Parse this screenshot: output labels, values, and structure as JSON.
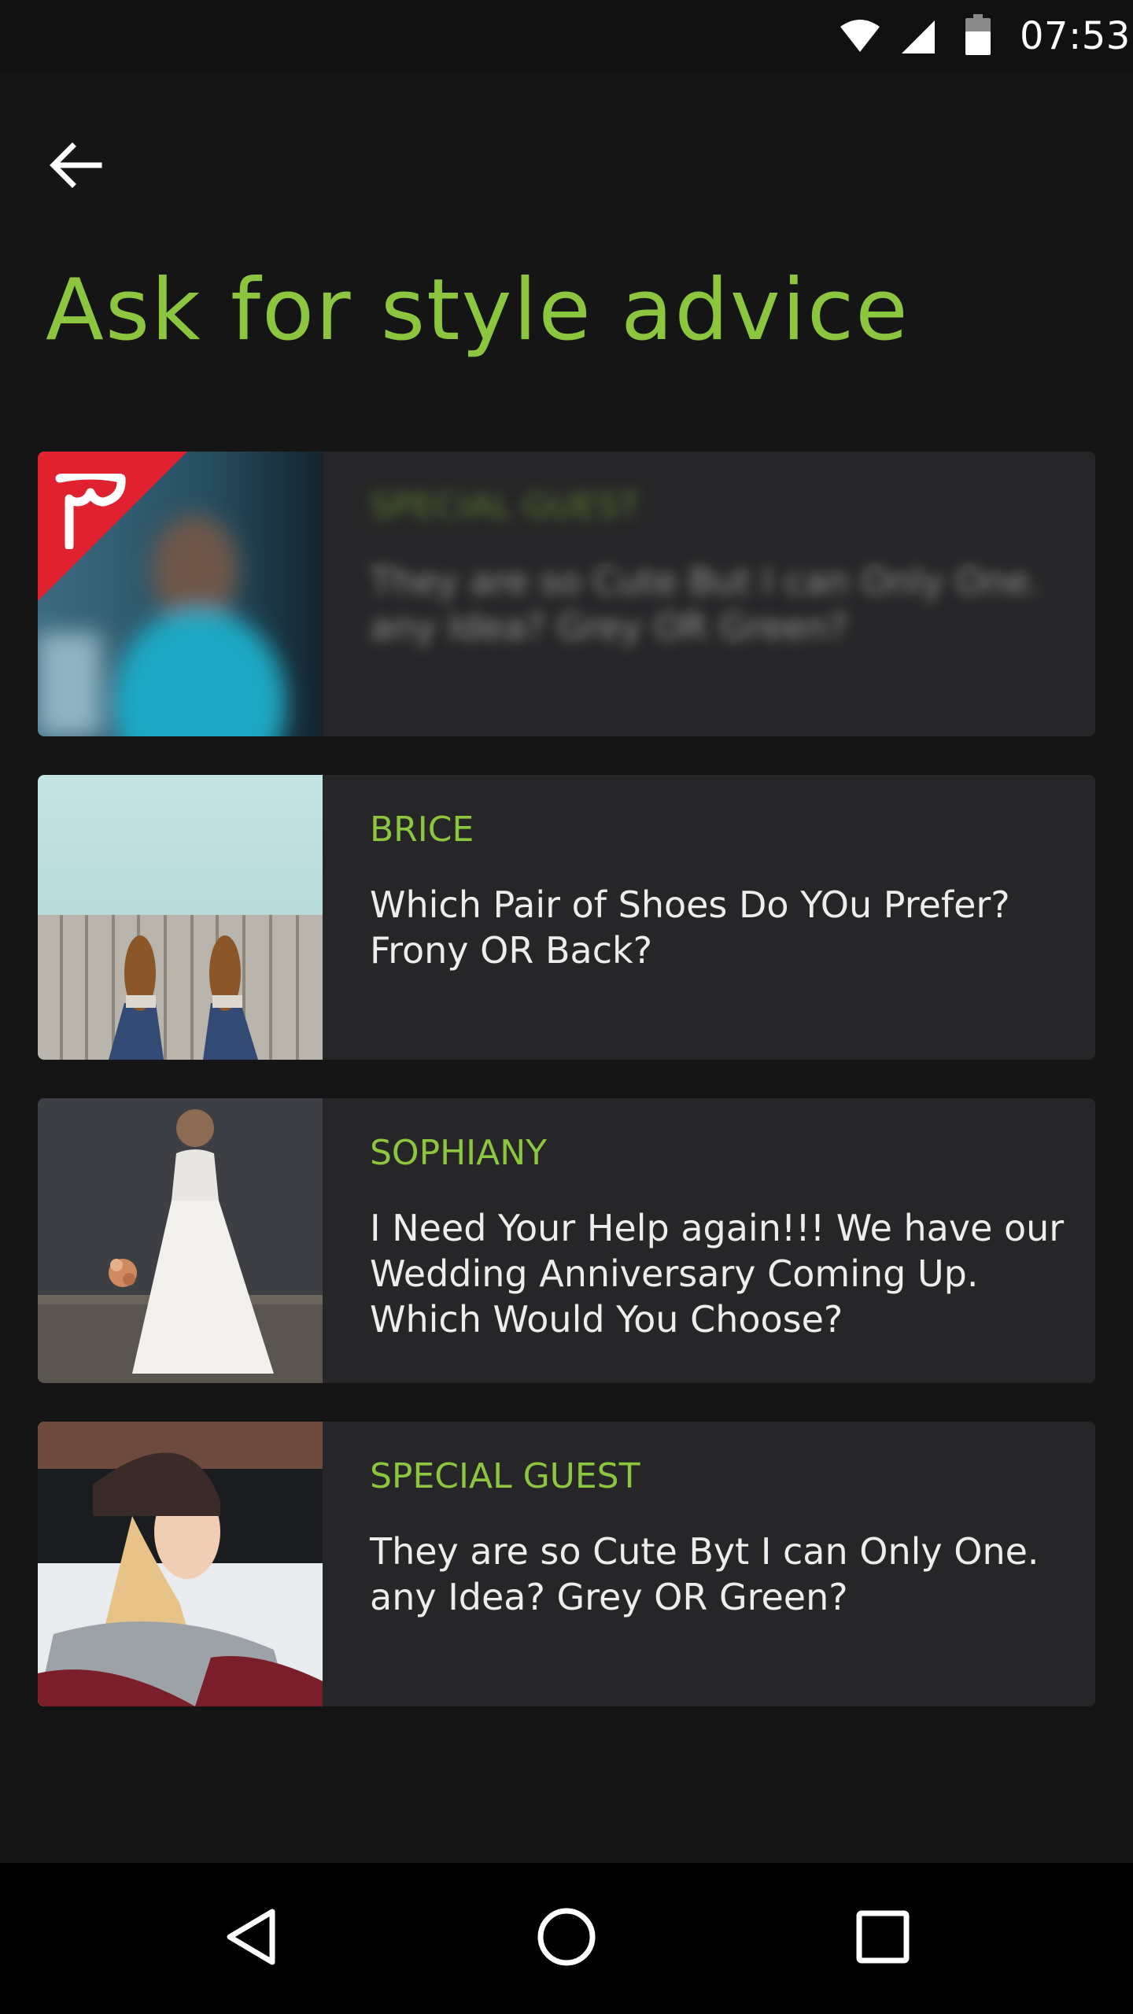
{
  "status_bar": {
    "time": "07:53",
    "icons": [
      "wifi-icon",
      "cell-signal-icon",
      "battery-icon"
    ]
  },
  "header": {
    "back_icon": "arrow-left-icon",
    "title": "Ask for style advice"
  },
  "colors": {
    "accent": "#8CC63F",
    "background": "#161516",
    "card": "#262527",
    "badge": "#E0212F"
  },
  "posts": [
    {
      "author": "SPECIAL GUEST",
      "question": "They are so Cute But I can Only One. any Idea? Grey OR Green?",
      "blurred": true,
      "badge_icon": "mask-icon",
      "thumbnail": "blurred-portrait-image"
    },
    {
      "author": "BRICE",
      "question": "Which Pair of Shoes Do YOu Prefer? Frony OR Back?",
      "blurred": false,
      "thumbnail": "shoes-on-pier-image"
    },
    {
      "author": "SOPHIANY",
      "question": "I Need Your Help again!!! We have our Wedding Anniversary Coming Up. Which Would You Choose?",
      "blurred": false,
      "thumbnail": "bride-in-white-dress-image"
    },
    {
      "author": "SPECIAL GUEST",
      "question": "They are so Cute Byt I can Only One. any Idea? Grey OR Green?",
      "blurred": false,
      "thumbnail": "woman-in-beanie-image"
    }
  ],
  "nav_bar": {
    "icons": [
      "back-triangle-icon",
      "home-circle-icon",
      "recents-square-icon"
    ]
  }
}
